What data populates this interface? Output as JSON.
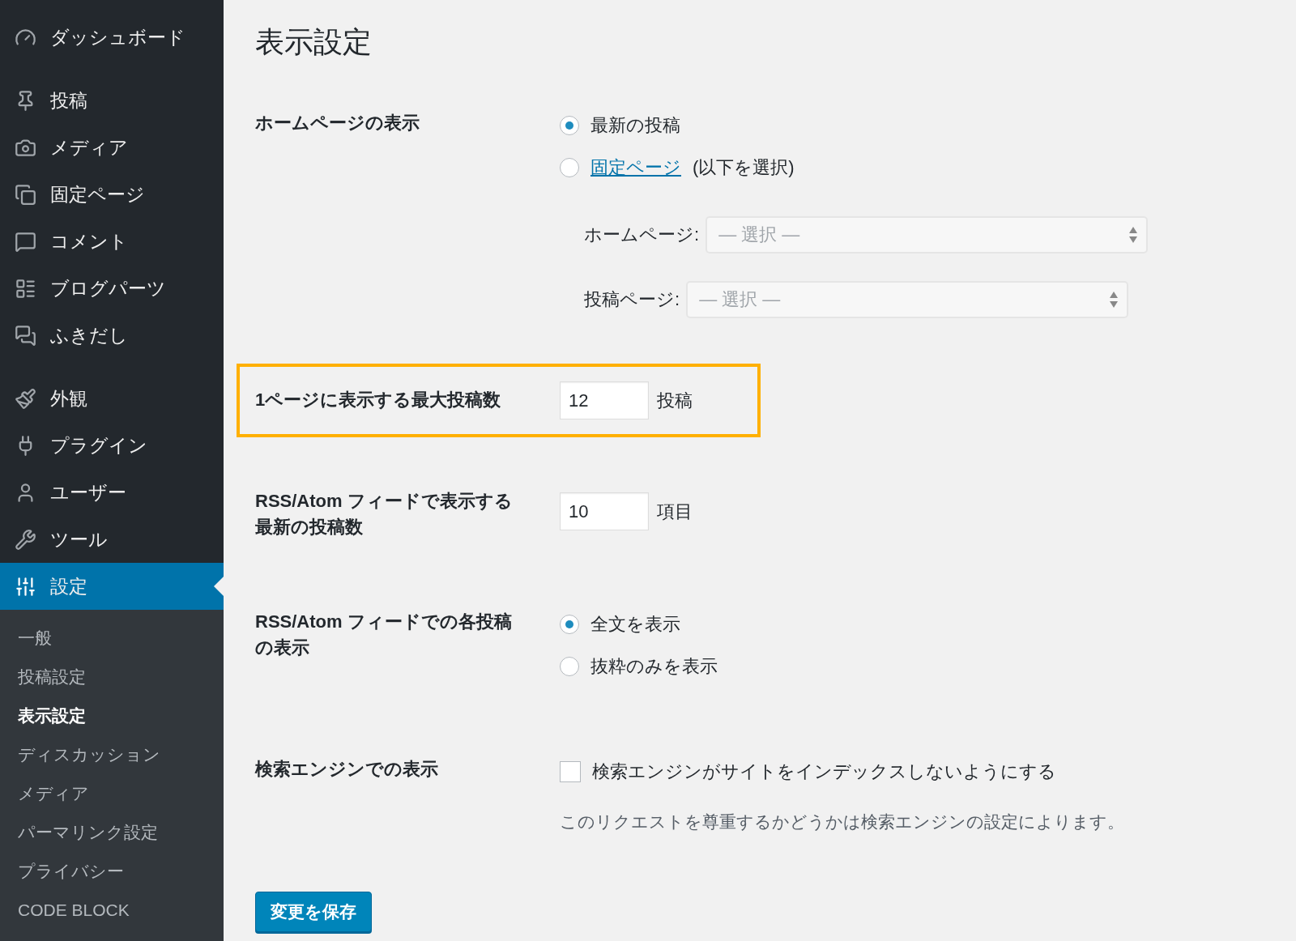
{
  "sidebar": {
    "groups": [
      [
        {
          "label": "ダッシュボード",
          "selected": false
        }
      ],
      [
        {
          "label": "投稿",
          "selected": false
        },
        {
          "label": "メディア",
          "selected": false
        },
        {
          "label": "固定ページ",
          "selected": false
        },
        {
          "label": "コメント",
          "selected": false
        },
        {
          "label": "ブログパーツ",
          "selected": false
        },
        {
          "label": "ふきだし",
          "selected": false
        }
      ],
      [
        {
          "label": "外観",
          "selected": false
        },
        {
          "label": "プラグイン",
          "selected": false
        },
        {
          "label": "ユーザー",
          "selected": false
        },
        {
          "label": "ツール",
          "selected": false
        },
        {
          "label": "設定",
          "selected": true
        }
      ]
    ],
    "submenu": [
      {
        "label": "一般",
        "selected": false
      },
      {
        "label": "投稿設定",
        "selected": false
      },
      {
        "label": "表示設定",
        "selected": true
      },
      {
        "label": "ディスカッション",
        "selected": false
      },
      {
        "label": "メディア",
        "selected": false
      },
      {
        "label": "パーマリンク設定",
        "selected": false
      },
      {
        "label": "プライバシー",
        "selected": false
      },
      {
        "label": "CODE BLOCK",
        "selected": false
      }
    ]
  },
  "page_title": "表示設定",
  "rows": [
    {
      "kind": "radio-group",
      "label": "ホームページの表示",
      "highlighted": false,
      "options": [
        {
          "label": "最新の投稿",
          "selected": true
        },
        {
          "link": "固定ページ",
          "label": "(以下を選択)",
          "selected": false
        }
      ],
      "selects": [
        {
          "label": "ホームページ:",
          "placeholder": "— 選択 —"
        },
        {
          "label": "投稿ページ:",
          "placeholder": "— 選択 —"
        }
      ]
    },
    {
      "kind": "number",
      "label": "1ページに表示する最大投稿数",
      "highlighted": true,
      "value": "12",
      "unit": "投稿"
    },
    {
      "kind": "number",
      "label": "RSS/Atom フィードで表示する最新の投稿数",
      "highlighted": false,
      "value": "10",
      "unit": "項目"
    },
    {
      "kind": "radio-group",
      "label": "RSS/Atom フィードでの各投稿の表示",
      "highlighted": false,
      "options": [
        {
          "label": "全文を表示",
          "selected": true
        },
        {
          "label": "抜粋のみを表示",
          "selected": false
        }
      ]
    },
    {
      "kind": "checkbox",
      "label": "検索エンジンでの表示",
      "highlighted": false,
      "checked": false,
      "option": "検索エンジンがサイトをインデックスしないようにする",
      "description": "このリクエストを尊重するかどうかは検索エンジンの設定によります。"
    }
  ],
  "save_button": "変更を保存"
}
